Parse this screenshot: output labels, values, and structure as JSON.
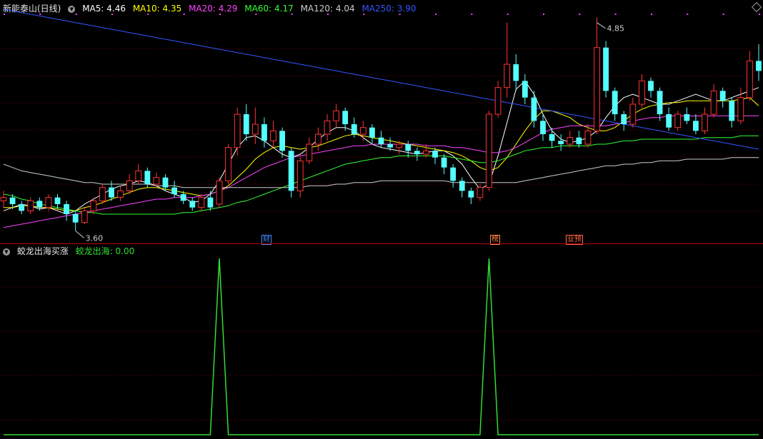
{
  "header": {
    "stock_title": "新能泰山(日线)",
    "ma": [
      {
        "label": "MA5: 4.46",
        "color": "#ffffff"
      },
      {
        "label": "MA10: 4.35",
        "color": "#ffff00"
      },
      {
        "label": "MA20: 4.29",
        "color": "#ff44ff"
      },
      {
        "label": "MA60: 4.17",
        "color": "#33ff33"
      },
      {
        "label": "MA120: 4.04",
        "color": "#cccccc"
      },
      {
        "label": "MA250: 3.90",
        "color": "#3355ff"
      }
    ]
  },
  "indicator": {
    "title": "蛟龙出海买涨",
    "value_label": "蛟龙出海: 0.00"
  },
  "event_tags": [
    {
      "label": "财",
      "color": "#4488ff"
    },
    {
      "label": "榜",
      "color": "#ff8844"
    },
    {
      "label": "业预",
      "color": "#ff6644"
    }
  ],
  "colors": {
    "up": "#ff3333",
    "down": "#54ffff",
    "grid": "#7a0000",
    "signal": "#33dd33"
  },
  "chart_data": [
    {
      "type": "candlestick",
      "title": "新能泰山(日线)",
      "y_range": [
        3.55,
        4.9
      ],
      "annotations": [
        {
          "label": "4.85",
          "value": 4.85,
          "kind": "high"
        },
        {
          "label": "3.60",
          "value": 3.6,
          "kind": "low"
        }
      ],
      "series": [
        {
          "name": "MA5",
          "color": "#ffffff",
          "values": [
            3.72,
            3.74,
            3.76,
            3.75,
            3.73,
            3.74,
            3.72,
            3.7,
            3.72,
            3.76,
            3.79,
            3.82,
            3.85,
            3.87,
            3.88,
            3.9,
            3.89,
            3.87,
            3.84,
            3.82,
            3.8,
            3.77,
            3.78,
            3.82,
            3.9,
            4.0,
            4.1,
            4.16,
            4.17,
            4.14,
            4.1,
            4.06,
            4.04,
            4.06,
            4.1,
            4.15,
            4.19,
            4.22,
            4.22,
            4.2,
            4.16,
            4.12,
            4.1,
            4.09,
            4.08,
            4.07,
            4.06,
            4.07,
            4.08,
            4.08,
            4.05,
            4.0,
            3.92,
            3.85,
            3.88,
            4.05,
            4.25,
            4.45,
            4.5,
            4.42,
            4.3,
            4.2,
            4.15,
            4.13,
            4.14,
            4.16,
            4.2,
            4.28,
            4.35,
            4.4,
            4.42,
            4.4,
            4.38,
            4.36,
            4.36,
            4.38,
            4.4,
            4.42,
            4.4,
            4.38,
            4.38,
            4.4,
            4.42,
            4.44,
            4.46
          ]
        },
        {
          "name": "MA10",
          "color": "#ffff00",
          "values": [
            3.74,
            3.74,
            3.75,
            3.75,
            3.74,
            3.74,
            3.73,
            3.72,
            3.72,
            3.74,
            3.75,
            3.77,
            3.79,
            3.81,
            3.83,
            3.85,
            3.86,
            3.86,
            3.85,
            3.84,
            3.83,
            3.82,
            3.81,
            3.82,
            3.84,
            3.87,
            3.92,
            3.97,
            4.03,
            4.07,
            4.1,
            4.11,
            4.1,
            4.09,
            4.1,
            4.11,
            4.13,
            4.15,
            4.17,
            4.18,
            4.17,
            4.16,
            4.15,
            4.14,
            4.13,
            4.12,
            4.11,
            4.1,
            4.09,
            4.08,
            4.07,
            4.05,
            4.02,
            3.98,
            3.96,
            3.98,
            4.04,
            4.12,
            4.2,
            4.27,
            4.32,
            4.32,
            4.3,
            4.28,
            4.24,
            4.22,
            4.2,
            4.2,
            4.22,
            4.26,
            4.3,
            4.33,
            4.35,
            4.36,
            4.37,
            4.37,
            4.38,
            4.38,
            4.38,
            4.38,
            4.38,
            4.38,
            4.39,
            4.4,
            4.35
          ]
        },
        {
          "name": "MA20",
          "color": "#ff44ff",
          "values": [
            3.62,
            3.63,
            3.64,
            3.65,
            3.66,
            3.67,
            3.68,
            3.69,
            3.7,
            3.71,
            3.72,
            3.73,
            3.74,
            3.75,
            3.76,
            3.77,
            3.78,
            3.79,
            3.79,
            3.8,
            3.8,
            3.8,
            3.81,
            3.82,
            3.84,
            3.86,
            3.89,
            3.92,
            3.95,
            3.98,
            4.0,
            4.02,
            4.04,
            4.05,
            4.06,
            4.07,
            4.08,
            4.09,
            4.1,
            4.11,
            4.11,
            4.12,
            4.12,
            4.12,
            4.12,
            4.12,
            4.12,
            4.11,
            4.11,
            4.11,
            4.1,
            4.1,
            4.09,
            4.08,
            4.07,
            4.07,
            4.08,
            4.1,
            4.13,
            4.16,
            4.19,
            4.21,
            4.22,
            4.23,
            4.23,
            4.23,
            4.23,
            4.23,
            4.24,
            4.25,
            4.26,
            4.27,
            4.28,
            4.28,
            4.29,
            4.29,
            4.29,
            4.29,
            4.29,
            4.29,
            4.29,
            4.29,
            4.29,
            4.29,
            4.29
          ]
        },
        {
          "name": "MA60",
          "color": "#33ff33",
          "values": [
            3.82,
            3.81,
            3.79,
            3.78,
            3.76,
            3.75,
            3.74,
            3.73,
            3.72,
            3.71,
            3.71,
            3.7,
            3.7,
            3.7,
            3.7,
            3.7,
            3.7,
            3.7,
            3.7,
            3.7,
            3.71,
            3.71,
            3.72,
            3.73,
            3.74,
            3.75,
            3.77,
            3.78,
            3.8,
            3.82,
            3.84,
            3.86,
            3.88,
            3.9,
            3.92,
            3.94,
            3.96,
            3.98,
            4.0,
            4.01,
            4.02,
            4.03,
            4.04,
            4.04,
            4.05,
            4.05,
            4.05,
            4.05,
            4.05,
            4.05,
            4.04,
            4.03,
            4.02,
            4.01,
            4.01,
            4.02,
            4.04,
            4.06,
            4.08,
            4.09,
            4.1,
            4.1,
            4.11,
            4.11,
            4.11,
            4.11,
            4.12,
            4.12,
            4.13,
            4.14,
            4.14,
            4.15,
            4.15,
            4.15,
            4.15,
            4.15,
            4.15,
            4.15,
            4.16,
            4.16,
            4.16,
            4.16,
            4.17,
            4.17,
            4.17
          ]
        },
        {
          "name": "MA120",
          "color": "#cccccc",
          "values": [
            4.0,
            3.98,
            3.96,
            3.95,
            3.94,
            3.93,
            3.92,
            3.91,
            3.9,
            3.89,
            3.89,
            3.88,
            3.88,
            3.88,
            3.88,
            3.88,
            3.88,
            3.87,
            3.87,
            3.87,
            3.86,
            3.86,
            3.86,
            3.86,
            3.86,
            3.86,
            3.86,
            3.86,
            3.86,
            3.86,
            3.86,
            3.86,
            3.86,
            3.86,
            3.87,
            3.87,
            3.87,
            3.88,
            3.88,
            3.89,
            3.89,
            3.89,
            3.9,
            3.9,
            3.9,
            3.9,
            3.9,
            3.9,
            3.9,
            3.9,
            3.89,
            3.89,
            3.89,
            3.89,
            3.89,
            3.89,
            3.89,
            3.89,
            3.9,
            3.91,
            3.92,
            3.93,
            3.94,
            3.95,
            3.96,
            3.97,
            3.98,
            3.99,
            3.99,
            4.0,
            4.0,
            4.01,
            4.01,
            4.02,
            4.02,
            4.02,
            4.03,
            4.03,
            4.03,
            4.03,
            4.03,
            4.04,
            4.04,
            4.04,
            4.04
          ]
        },
        {
          "name": "MA250",
          "color": "#3355ff",
          "values": [
            4.93,
            4.92,
            4.91,
            4.9,
            4.89,
            4.88,
            4.87,
            4.86,
            4.85,
            4.84,
            4.83,
            4.82,
            4.81,
            4.8,
            4.79,
            4.78,
            4.77,
            4.76,
            4.75,
            4.74,
            4.73,
            4.72,
            4.71,
            4.7,
            4.69,
            4.68,
            4.67,
            4.66,
            4.65,
            4.64,
            4.63,
            4.62,
            4.61,
            4.6,
            4.59,
            4.58,
            4.57,
            4.56,
            4.55,
            4.54,
            4.53,
            4.52,
            4.51,
            4.5,
            4.49,
            4.48,
            4.47,
            4.46,
            4.45,
            4.44,
            4.43,
            4.42,
            4.41,
            4.4,
            4.39,
            4.38,
            4.37,
            4.36,
            4.35,
            4.34,
            4.33,
            4.32,
            4.31,
            4.3,
            4.29,
            4.28,
            4.27,
            4.26,
            4.25,
            4.24,
            4.23,
            4.22,
            4.21,
            4.2,
            4.19,
            4.18,
            4.17,
            4.16,
            4.15,
            4.14,
            4.13,
            4.12,
            4.11,
            4.1,
            4.09
          ]
        }
      ],
      "candles": [
        [
          3.78,
          3.8,
          3.74,
          3.84
        ],
        [
          3.8,
          3.76,
          3.73,
          3.82
        ],
        [
          3.76,
          3.72,
          3.7,
          3.78
        ],
        [
          3.72,
          3.78,
          3.7,
          3.8
        ],
        [
          3.78,
          3.74,
          3.72,
          3.8
        ],
        [
          3.74,
          3.8,
          3.72,
          3.82
        ],
        [
          3.8,
          3.76,
          3.73,
          3.82
        ],
        [
          3.76,
          3.7,
          3.66,
          3.78
        ],
        [
          3.7,
          3.65,
          3.6,
          3.72
        ],
        [
          3.65,
          3.72,
          3.64,
          3.74
        ],
        [
          3.72,
          3.78,
          3.7,
          3.8
        ],
        [
          3.78,
          3.86,
          3.76,
          3.88
        ],
        [
          3.86,
          3.8,
          3.78,
          3.9
        ],
        [
          3.8,
          3.84,
          3.78,
          3.87
        ],
        [
          3.84,
          3.9,
          3.82,
          3.94
        ],
        [
          3.9,
          3.96,
          3.88,
          4.0
        ],
        [
          3.96,
          3.88,
          3.86,
          3.98
        ],
        [
          3.88,
          3.92,
          3.86,
          3.95
        ],
        [
          3.92,
          3.86,
          3.84,
          3.94
        ],
        [
          3.86,
          3.82,
          3.8,
          3.9
        ],
        [
          3.82,
          3.78,
          3.76,
          3.84
        ],
        [
          3.78,
          3.74,
          3.72,
          3.8
        ],
        [
          3.74,
          3.8,
          3.72,
          3.82
        ],
        [
          3.8,
          3.74,
          3.72,
          3.84
        ],
        [
          3.76,
          3.9,
          3.74,
          3.92
        ],
        [
          3.9,
          4.1,
          3.88,
          4.12
        ],
        [
          4.1,
          4.3,
          4.05,
          4.34
        ],
        [
          4.3,
          4.18,
          4.14,
          4.36
        ],
        [
          4.18,
          4.24,
          4.12,
          4.34
        ],
        [
          4.24,
          4.14,
          4.1,
          4.28
        ],
        [
          4.14,
          4.2,
          4.1,
          4.26
        ],
        [
          4.2,
          4.08,
          4.04,
          4.22
        ],
        [
          4.08,
          3.84,
          3.8,
          4.1
        ],
        [
          3.84,
          4.02,
          3.8,
          4.04
        ],
        [
          4.02,
          4.12,
          4.0,
          4.16
        ],
        [
          4.12,
          4.18,
          4.08,
          4.22
        ],
        [
          4.18,
          4.26,
          4.14,
          4.3
        ],
        [
          4.26,
          4.32,
          4.22,
          4.36
        ],
        [
          4.32,
          4.24,
          4.2,
          4.34
        ],
        [
          4.24,
          4.18,
          4.16,
          4.28
        ],
        [
          4.18,
          4.22,
          4.14,
          4.26
        ],
        [
          4.22,
          4.16,
          4.12,
          4.24
        ],
        [
          4.16,
          4.12,
          4.1,
          4.2
        ],
        [
          4.12,
          4.1,
          4.08,
          4.16
        ],
        [
          4.1,
          4.12,
          4.06,
          4.14
        ],
        [
          4.12,
          4.08,
          4.04,
          4.14
        ],
        [
          4.08,
          4.06,
          4.02,
          4.1
        ],
        [
          4.06,
          4.08,
          4.04,
          4.12
        ],
        [
          4.08,
          4.04,
          4.0,
          4.1
        ],
        [
          4.04,
          3.98,
          3.94,
          4.06
        ],
        [
          3.98,
          3.9,
          3.86,
          4.0
        ],
        [
          3.9,
          3.84,
          3.8,
          3.92
        ],
        [
          3.84,
          3.8,
          3.76,
          3.86
        ],
        [
          3.8,
          3.86,
          3.78,
          3.88
        ],
        [
          3.86,
          4.3,
          3.84,
          4.32
        ],
        [
          4.3,
          4.46,
          4.28,
          4.5
        ],
        [
          4.46,
          4.6,
          4.4,
          4.85
        ],
        [
          4.6,
          4.5,
          4.44,
          4.66
        ],
        [
          4.5,
          4.4,
          4.36,
          4.54
        ],
        [
          4.4,
          4.26,
          4.22,
          4.44
        ],
        [
          4.26,
          4.18,
          4.14,
          4.3
        ],
        [
          4.18,
          4.14,
          4.1,
          4.22
        ],
        [
          4.14,
          4.12,
          4.08,
          4.18
        ],
        [
          4.12,
          4.16,
          4.1,
          4.2
        ],
        [
          4.16,
          4.12,
          4.1,
          4.2
        ],
        [
          4.12,
          4.2,
          4.1,
          4.24
        ],
        [
          4.2,
          4.7,
          4.18,
          4.88
        ],
        [
          4.7,
          4.44,
          4.4,
          4.74
        ],
        [
          4.44,
          4.3,
          4.26,
          4.46
        ],
        [
          4.3,
          4.24,
          4.2,
          4.32
        ],
        [
          4.24,
          4.36,
          4.22,
          4.4
        ],
        [
          4.36,
          4.5,
          4.34,
          4.54
        ],
        [
          4.5,
          4.44,
          4.4,
          4.52
        ],
        [
          4.44,
          4.3,
          4.26,
          4.46
        ],
        [
          4.3,
          4.22,
          4.2,
          4.34
        ],
        [
          4.22,
          4.3,
          4.2,
          4.32
        ],
        [
          4.3,
          4.26,
          4.24,
          4.34
        ],
        [
          4.26,
          4.2,
          4.18,
          4.3
        ],
        [
          4.2,
          4.3,
          4.18,
          4.34
        ],
        [
          4.3,
          4.44,
          4.28,
          4.48
        ],
        [
          4.44,
          4.38,
          4.34,
          4.46
        ],
        [
          4.38,
          4.26,
          4.22,
          4.4
        ],
        [
          4.26,
          4.4,
          4.24,
          4.46
        ],
        [
          4.4,
          4.62,
          4.38,
          4.68
        ],
        [
          4.62,
          4.56,
          4.5,
          4.72
        ]
      ]
    },
    {
      "type": "line",
      "title": "蛟龙出海买涨",
      "y_range": [
        0,
        1
      ],
      "series": [
        {
          "name": "蛟龙出海",
          "color": "#33dd33",
          "values": [
            0,
            0,
            0,
            0,
            0,
            0,
            0,
            0,
            0,
            0,
            0,
            0,
            0,
            0,
            0,
            0,
            0,
            0,
            0,
            0,
            0,
            0,
            0,
            0,
            1,
            0,
            0,
            0,
            0,
            0,
            0,
            0,
            0,
            0,
            0,
            0,
            0,
            0,
            0,
            0,
            0,
            0,
            0,
            0,
            0,
            0,
            0,
            0,
            0,
            0,
            0,
            0,
            0,
            0,
            1,
            0,
            0,
            0,
            0,
            0,
            0,
            0,
            0,
            0,
            0,
            0,
            0,
            0,
            0,
            0,
            0,
            0,
            0,
            0,
            0,
            0,
            0,
            0,
            0,
            0,
            0,
            0,
            0,
            0,
            0
          ]
        }
      ]
    }
  ]
}
